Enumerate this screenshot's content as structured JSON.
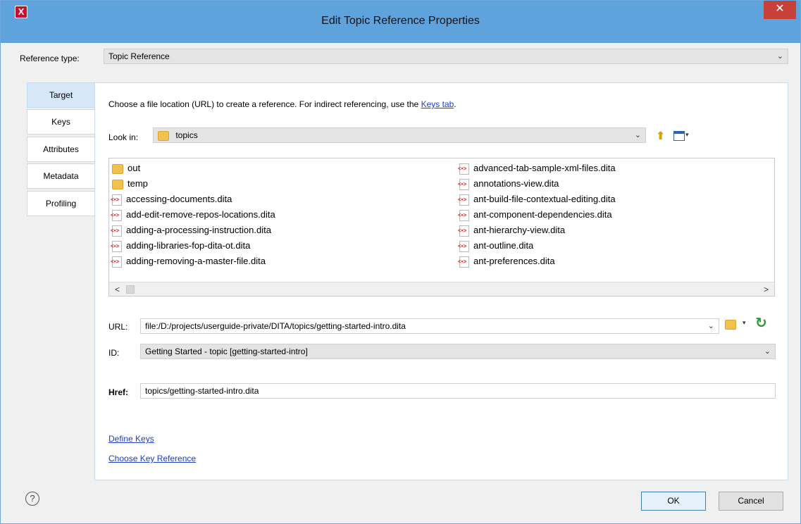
{
  "window": {
    "title": "Edit Topic Reference Properties",
    "close_label": "✕"
  },
  "reference_type": {
    "label": "Reference type:",
    "value": "Topic Reference"
  },
  "tabs": [
    {
      "label": "Target",
      "active": true
    },
    {
      "label": "Keys",
      "active": false
    },
    {
      "label": "Attributes",
      "active": false
    },
    {
      "label": "Metadata",
      "active": false
    },
    {
      "label": "Profiling",
      "active": false
    }
  ],
  "target": {
    "intro_text": "Choose a file location (URL) to create a reference. For indirect referencing, use the",
    "intro_link": "Keys tab",
    "intro_end": ".",
    "look_in_label": "Look in:",
    "look_in_value": "topics",
    "files_left": [
      {
        "name": "out",
        "type": "folder"
      },
      {
        "name": "temp",
        "type": "folder"
      },
      {
        "name": "accessing-documents.dita",
        "type": "dita"
      },
      {
        "name": "add-edit-remove-repos-locations.dita",
        "type": "dita"
      },
      {
        "name": "adding-a-processing-instruction.dita",
        "type": "dita"
      },
      {
        "name": "adding-libraries-fop-dita-ot.dita",
        "type": "dita"
      },
      {
        "name": "adding-removing-a-master-file.dita",
        "type": "dita"
      }
    ],
    "files_right": [
      {
        "name": "advanced-tab-sample-xml-files.dita",
        "type": "dita"
      },
      {
        "name": "annotations-view.dita",
        "type": "dita"
      },
      {
        "name": "ant-build-file-contextual-editing.dita",
        "type": "dita"
      },
      {
        "name": "ant-component-dependencies.dita",
        "type": "dita"
      },
      {
        "name": "ant-hierarchy-view.dita",
        "type": "dita"
      },
      {
        "name": "ant-outline.dita",
        "type": "dita"
      },
      {
        "name": "ant-preferences.dita",
        "type": "dita"
      }
    ],
    "scroll_left": "<",
    "scroll_right": ">",
    "url_label": "URL:",
    "url_value": "file:/D:/projects/userguide-private/DITA/topics/getting-started-intro.dita",
    "id_label": "ID:",
    "id_value": "Getting Started - topic [getting-started-intro]",
    "href_label": "Href:",
    "href_value": "topics/getting-started-intro.dita",
    "define_keys": "Define Keys",
    "choose_key_reference": "Choose Key Reference"
  },
  "footer": {
    "help_label": "?",
    "ok_label": "OK",
    "cancel_label": "Cancel"
  }
}
